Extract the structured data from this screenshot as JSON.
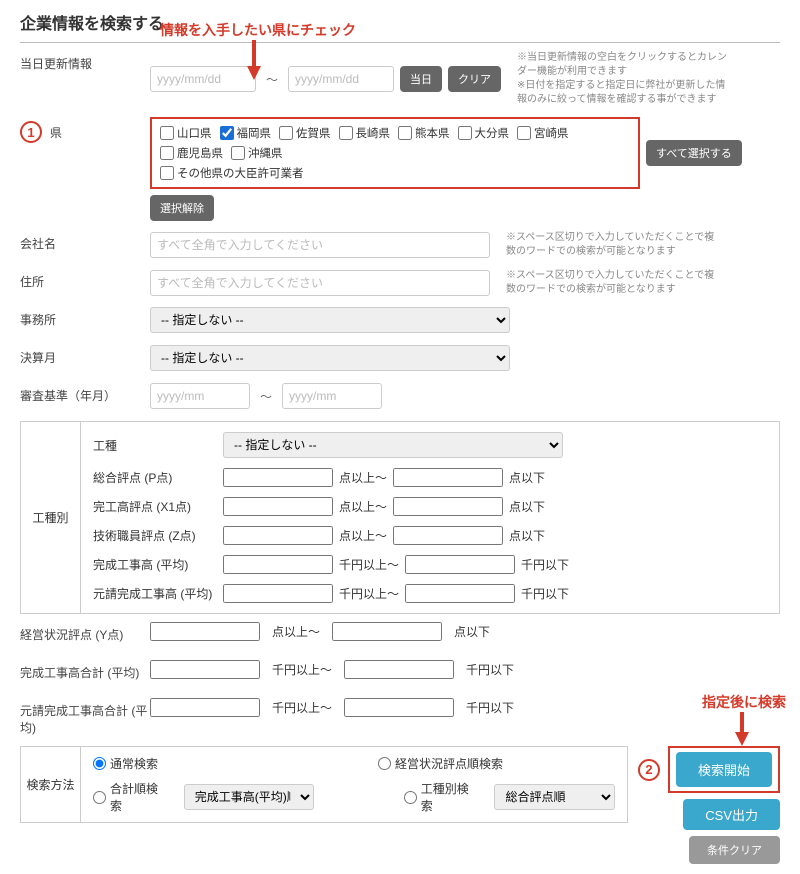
{
  "title": "企業情報を検索する",
  "annot": {
    "top": "情報を入手したい県にチェック",
    "right": "指定後に検索",
    "b1": "1",
    "b2": "2"
  },
  "labels": {
    "date": "当日更新情報",
    "pref": "県",
    "company": "会社名",
    "address": "住所",
    "office": "事務所",
    "fiscal": "決算月",
    "review": "審査基準（年月）",
    "kind": "工種別",
    "ktype": "工種",
    "sogo": "総合評点 (P点)",
    "kanko": "完工高評点 (X1点)",
    "gijutsu": "技術職員評点 (Z点)",
    "kanko_avg": "完成工事高 (平均)",
    "motouke": "元請完成工事高 (平均)",
    "keiei": "経営状況評点 (Y点)",
    "kanko_total": "完成工事高合計 (平均)",
    "motouke_total": "元請完成工事高合計 (平均)",
    "smethod": "検索方法"
  },
  "placeholders": {
    "date": "yyyy/mm/dd",
    "name": "すべて全角で入力してください",
    "ym": "yyyy/mm"
  },
  "units": {
    "pt_above": "点以上～",
    "pt_below": "点以下",
    "yen_above": "千円以上～",
    "yen_below": "千円以下"
  },
  "selects": {
    "none": "-- 指定しない --",
    "kanko_order": "完成工事高(平均)順",
    "sogo_order": "総合評点順"
  },
  "hints": {
    "date1": "※当日更新情報の空白をクリックするとカレンダー機能が利用できます",
    "date2": "※日付を指定すると指定日に弊社が更新した情報のみに絞って情報を確認する事ができます",
    "space": "※スペース区切りで入力していただくことで複数のワードでの検索が可能となります"
  },
  "btns": {
    "today": "当日",
    "clear": "クリア",
    "select_all": "すべて選択する",
    "deselect": "選択解除",
    "search": "検索開始",
    "csv": "CSV出力",
    "cond_clear": "条件クリア"
  },
  "prefs": [
    "山口県",
    "福岡県",
    "佐賀県",
    "長崎県",
    "熊本県",
    "大分県",
    "宮崎県",
    "鹿児島県",
    "沖縄県",
    "その他県の大臣許可業者"
  ],
  "smethod": {
    "r1": "通常検索",
    "r2": "経営状況評点順検索",
    "r3": "合計順検索",
    "r4": "工種別検索"
  },
  "tilde": "～"
}
